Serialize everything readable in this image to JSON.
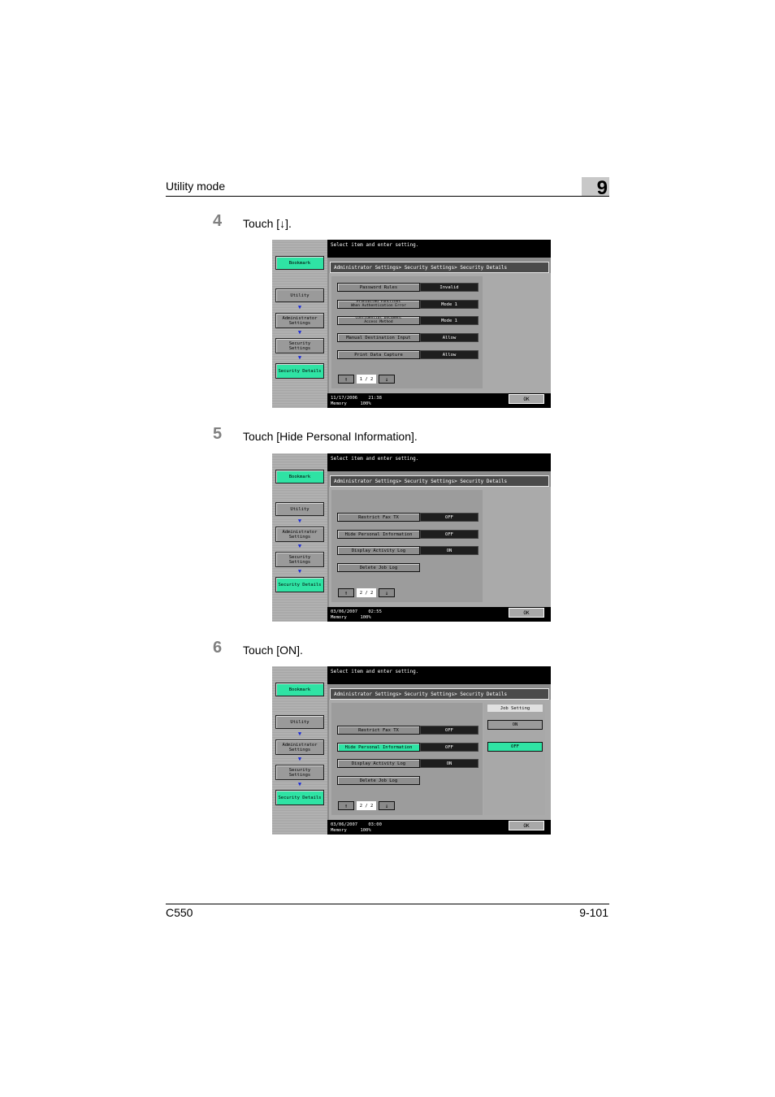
{
  "header": {
    "section": "Utility mode",
    "chapter": "9"
  },
  "footer": {
    "model": "C550",
    "page": "9-101"
  },
  "steps": [
    {
      "number": "4",
      "text": "Touch [↓]."
    },
    {
      "number": "5",
      "text": "Touch [Hide Personal Information]."
    },
    {
      "number": "6",
      "text": "Touch [ON]."
    }
  ],
  "screen_common": {
    "message": "Select item and enter setting.",
    "breadcrumb": "Administrator Settings> Security Settings> Security Details",
    "bookmark": "Bookmark",
    "utility": "Utility",
    "admin_l1": "Administrator",
    "admin_l2": "Settings",
    "security_l1": "Security",
    "security_l2": "Settings",
    "security_details": "Security Details",
    "ok": "OK",
    "up_arrow": "↑",
    "down_arrow": "↓",
    "memory_label": "Memory",
    "memory_value": "100%"
  },
  "screen1": {
    "page_indicator": "1 / 2",
    "date": "11/17/2006",
    "time": "21:38",
    "items": [
      {
        "label": "Password Rules",
        "value": "Invalid"
      },
      {
        "label_l1": "Prohibited Functions",
        "label_l2": "When Authentication Error",
        "value": "Mode 1"
      },
      {
        "label_l1": "Confidential Document",
        "label_l2": "Access Method",
        "value": "Mode 1"
      },
      {
        "label": "Manual Destination Input",
        "value": "Allow"
      },
      {
        "label": "Print Data Capture",
        "value": "Allow"
      }
    ]
  },
  "screen2": {
    "page_indicator": "2 / 2",
    "date": "03/06/2007",
    "time": "02:55",
    "items": [
      {
        "label": "Restrict Fax TX",
        "value": "OFF"
      },
      {
        "label": "Hide Personal Information",
        "value": "OFF"
      },
      {
        "label": "Display Activity Log",
        "value": "ON"
      },
      {
        "label": "Delete Job Log"
      }
    ]
  },
  "screen3": {
    "page_indicator": "2 / 2",
    "date": "03/06/2007",
    "time": "03:00",
    "items": [
      {
        "label": "Restrict Fax TX",
        "value": "OFF"
      },
      {
        "label": "Hide Personal Information",
        "value": "OFF"
      },
      {
        "label": "Display Activity Log",
        "value": "ON"
      },
      {
        "label": "Delete Job Log"
      }
    ],
    "job_setting": {
      "title": "Job Setting",
      "on": "ON",
      "off": "OFF"
    }
  },
  "colors": {
    "highlight_green": "#2fe3a4",
    "arrow_blue": "#1c2bd8"
  }
}
